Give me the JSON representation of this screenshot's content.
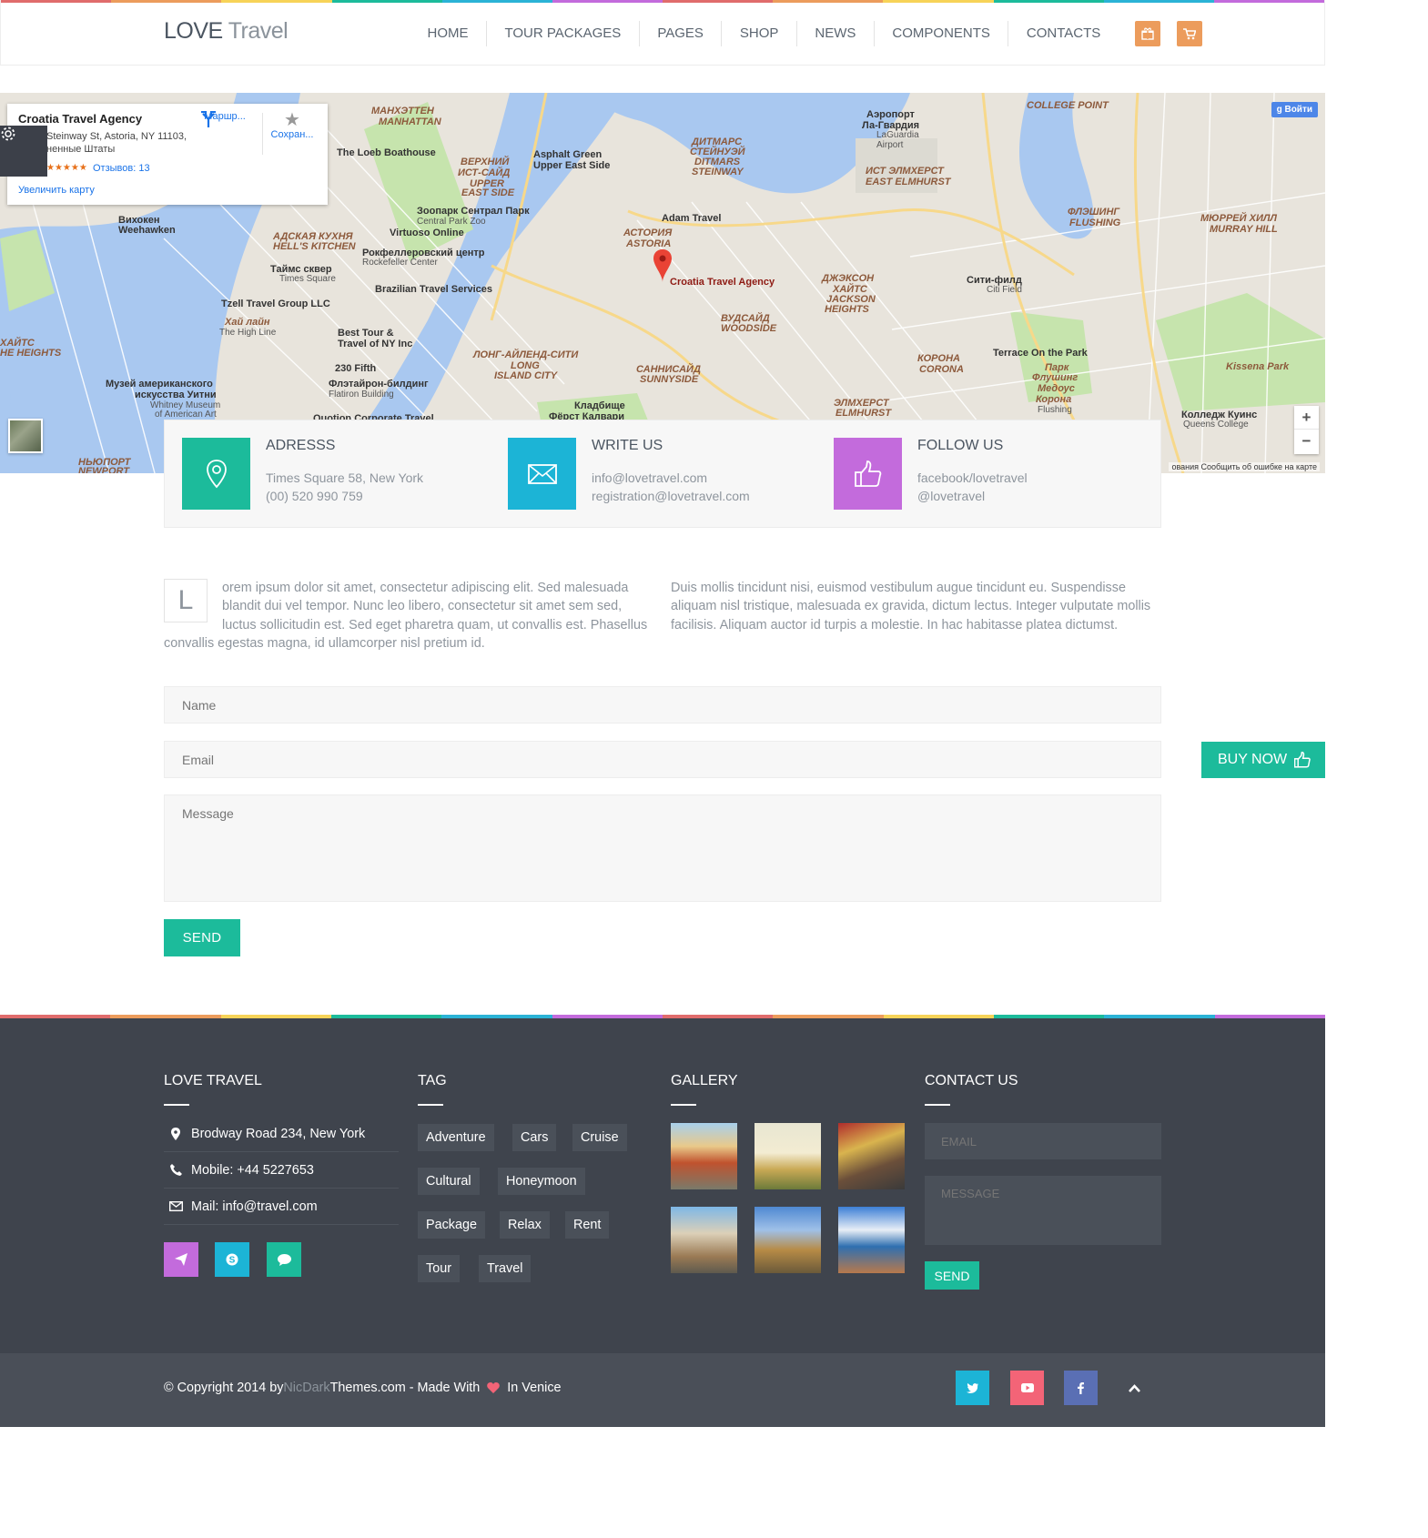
{
  "colors": {
    "stripe": [
      "#e06c6c",
      "#ec9c5c",
      "#f7d358",
      "#1cbb9b",
      "#2bb3d6",
      "#c36bdc",
      "#e06c6c",
      "#ec9c5c",
      "#f7d358",
      "#1cbb9b",
      "#2bb3d6",
      "#c36bdc"
    ],
    "green": "#1cbb9b",
    "blue": "#1cb4d6",
    "purple": "#c36bdc",
    "orange": "#ec9c5c",
    "pink": "#f36477",
    "fb": "#5a6fb4"
  },
  "header": {
    "logo_part1": "LOVE",
    "logo_part2": "Travel",
    "nav": [
      "HOME",
      "TOUR PACKAGES",
      "PAGES",
      "SHOP",
      "NEWS",
      "COMPONENTS",
      "CONTACTS"
    ],
    "icons": [
      "gift-icon",
      "cart-icon"
    ]
  },
  "map": {
    "card_title": "Croatia Travel Agency",
    "card_address": "Steinway St, Astoria, NY 11103, ненные Штаты",
    "card_rating": "★★★★★",
    "card_reviews": "Отзывов: 13",
    "card_route": "Маршр...",
    "card_save": "Сохран...",
    "card_enlarge": "Увеличить карту",
    "signin": "Войти",
    "zoom_in": "+",
    "zoom_out": "−",
    "report": "ования   Сообщить об ошибке на карте",
    "marker_label": "Croatia Travel Agency",
    "labels": [
      "МАНХЭТТЕН",
      "MANHATTAN",
      "The Loeb Boathouse",
      "Asphalt Green",
      "Upper East Side",
      "ВЕРХНИЙ",
      "ИСТ-САЙД",
      "UPPER",
      "EAST SIDE",
      "Зоопарк Сентрал Парк",
      "Central Park Zoo",
      "Virtuoso Online",
      "АДСКАЯ КУХНЯ",
      "HELL'S KITCHEN",
      "Рокфеллеровский центр",
      "Rockefeller Center",
      "Таймс сквер",
      "Times Square",
      "Brazilian Travel Services",
      "Tzell Travel Group LLC",
      "Хай лайн",
      "The High Line",
      "Best Tour &",
      "Travel of NY Inc",
      "230 Fifth",
      "Флэтайрон-билдинг",
      "Flatiron Building",
      "Музей американского",
      "искусства Уитни",
      "Whitney Museum",
      "of American Art",
      "Вихокен",
      "Weehawken",
      "ХАЙТС",
      "HE HEIGHTS",
      "НЬЮПОРТ",
      "NEWPORT",
      "Adam Travel",
      "АСТОРИЯ",
      "ASTORIA",
      "ДИТМАРС",
      "СТЕЙНУЭЙ",
      "DITMARS",
      "STEINWAY",
      "Аэропорт",
      "Ла-Гвардия",
      "LaGuardia",
      "Airport",
      "ИСТ ЭЛМХЕРСТ",
      "EAST ELMHURST",
      "COLLEGE POINT",
      "ФЛЭШИНГ",
      "FLUSHING",
      "МЮРРЕЙ ХИЛЛ",
      "MURRAY HILL",
      "ДЖЭКСОН",
      "ХАЙТС",
      "JACKSON",
      "HEIGHTS",
      "ВУДСАЙД",
      "WOODSIDE",
      "Сити-филд",
      "Citi Field",
      "КОРОНА",
      "CORONA",
      "Terrace On the Park",
      "Парк",
      "Флушинг",
      "Медоус",
      "Корона",
      "Flushing",
      "Kissena Park",
      "Колледж Куинс",
      "Queens College",
      "ЛОНГ-АЙЛЕНД-СИТИ",
      "LONG",
      "ISLAND CITY",
      "САННИСАЙД",
      "SUNNYSIDE",
      "Кладбище",
      "Фёрст Калвари",
      "ЭЛМХЕРСТ",
      "ELMHURST",
      "Quotion Corporate Travel"
    ]
  },
  "info": [
    {
      "icon": "map-pin-icon",
      "title": "ADRESSS",
      "line1": "Times Square 58, New York",
      "line2": "(00) 520 990 759"
    },
    {
      "icon": "envelope-icon",
      "title": "WRITE US",
      "line1": "info@lovetravel.com",
      "line2": "registration@lovetravel.com"
    },
    {
      "icon": "thumbs-up-icon",
      "title": "FOLLOW US",
      "line1": "facebook/lovetravel",
      "line2": "@lovetravel"
    }
  ],
  "intro": {
    "dropcap": "L",
    "left": "orem ipsum dolor sit amet, consectetur adipiscing elit. Sed malesuada blandit dui vel tempor. Nunc leo libero, consectetur sit amet sem sed, luctus sollicitudin est. Sed eget pharetra quam, ut convallis est. Phasellus convallis egestas magna, id ullamcorper nisl pretium id.",
    "right": "Duis mollis tincidunt nisi, euismod vestibulum augue tincidunt eu. Suspendisse aliquam nisl tristique, malesuada ex gravida, dictum lectus. Integer vulputate mollis facilisis. Aliquam auctor id turpis a molestie. In hac habitasse platea dictumst."
  },
  "form": {
    "name_placeholder": "Name",
    "email_placeholder": "Email",
    "message_placeholder": "Message",
    "send": "SEND"
  },
  "buy_now": "BUY NOW",
  "footer": {
    "col1_title": "LOVE TRAVEL",
    "address": "Brodway Road 234, New York",
    "mobile": "Mobile: +44 5227653",
    "mail": "Mail: info@travel.com",
    "social_icons": [
      "paper-plane-icon",
      "skype-icon",
      "chat-icon"
    ],
    "col2_title": "TAG",
    "tags": [
      "Adventure",
      "Cars",
      "Cruise",
      "Cultural",
      "Honeymoon",
      "Package",
      "Relax",
      "Rent",
      "Tour",
      "Travel"
    ],
    "col3_title": "GALLERY",
    "col4_title": "CONTACT US",
    "email_placeholder": "EMAIL",
    "message_placeholder": "MESSAGE",
    "send": "SEND"
  },
  "bottom": {
    "copy1": "© Copyright 2014 by ",
    "copy_dim": "NicDark",
    "copy2": "Themes.com - Made With ",
    "copy3": " In Venice",
    "social": [
      "twitter-icon",
      "youtube-icon",
      "facebook-icon"
    ]
  }
}
